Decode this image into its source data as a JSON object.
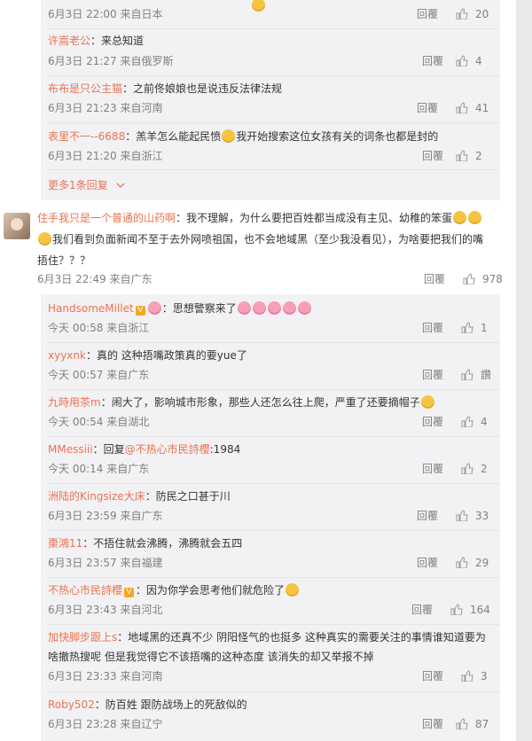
{
  "thread1_replies": [
    {
      "user": "",
      "content": "",
      "emojis": 1,
      "date": "6月3日 22:00 来自日本",
      "reply": "回覆",
      "likes": "20"
    },
    {
      "user": "许嵩老公",
      "content": "：来总知道",
      "date": "6月3日 21:27 来自俄罗斯",
      "reply": "回覆",
      "likes": "4"
    },
    {
      "user": "布布是只公主猫",
      "content": "：之前佟娘娘也是说违反法律法规",
      "date": "6月3日 21:23 来自河南",
      "reply": "回覆",
      "likes": "41"
    },
    {
      "user": "表里不一--6688",
      "content_a": "：羔羊怎么能起民愤",
      "content_b": "我开始搜索这位女孩有关的词条也都是封的",
      "date": "6月3日 21:20 来自浙江",
      "reply": "回覆",
      "likes": "2"
    }
  ],
  "thread1_more": "更多1条回复",
  "main_comment": {
    "user": "住手我只是一个普通的山药啊",
    "line1": "：我不理解，为什么要把百姓都当成没有主见、幼稚的笨蛋",
    "line2": "我们看到负面新闻不至于去外网喷祖国，也不会地域黑（至少我没看见），为啥要把我们的嘴",
    "line3": "捂住？？？",
    "date": "6月3日 22:49 来自广东",
    "reply": "回覆",
    "likes": "978"
  },
  "replies": [
    {
      "user": "HandsomeMillet",
      "badge": "V",
      "content": "：思想警察来了",
      "date": "今天 00:58 来自浙江",
      "reply": "回覆",
      "likes": "1"
    },
    {
      "user": "xyyxnk",
      "content": "：真的 这种捂嘴政策真的要yue了",
      "date": "今天 00:57 来自广东",
      "reply": "回覆",
      "likes": "讚"
    },
    {
      "user": "九時用茶m",
      "content": "：闹大了，影响城市形象，那些人还怎么往上爬，严重了还要摘帽子",
      "date": "今天 00:54 来自湖北",
      "reply": "回覆",
      "likes": "4"
    },
    {
      "user": "MMessiii",
      "content_a": "：回复",
      "mention": "@不热心市民詩櫻",
      "content_b": ":1984",
      "date": "今天 00:14 来自广东",
      "reply": "回覆",
      "likes": "2"
    },
    {
      "user": "洲陆的Kingsize大床",
      "content": "：防民之口甚于川",
      "date": "6月3日 23:59 来自广东",
      "reply": "回覆",
      "likes": "33"
    },
    {
      "user": "棗鴻11",
      "content": "：不捂住就会沸腾，沸腾就会五四",
      "date": "6月3日 23:57 来自福建",
      "reply": "回覆",
      "likes": "29"
    },
    {
      "user": "不热心市民詩櫻",
      "badge": "V",
      "content": "：因为你学会思考他们就危险了",
      "date": "6月3日 23:43 来自河北",
      "reply": "回覆",
      "likes": "164"
    },
    {
      "user": "加快脚步跟上s",
      "content": "：地域黑的还真不少 阴阳怪气的也挺多 这种真实的需要关注的事情谁知道要为",
      "content2": "啥撤热搜呢 但是我觉得它不该捂嘴的这种态度 该消失的却又举报不掉",
      "date": "6月3日 23:33 来自河南",
      "reply": "回覆",
      "likes": "3"
    },
    {
      "user": "Roby502",
      "content": "：防百姓 跟防战场上的死敌似的",
      "date": "6月3日 23:28 来自辽宁",
      "reply": "回覆",
      "likes": "87"
    }
  ]
}
